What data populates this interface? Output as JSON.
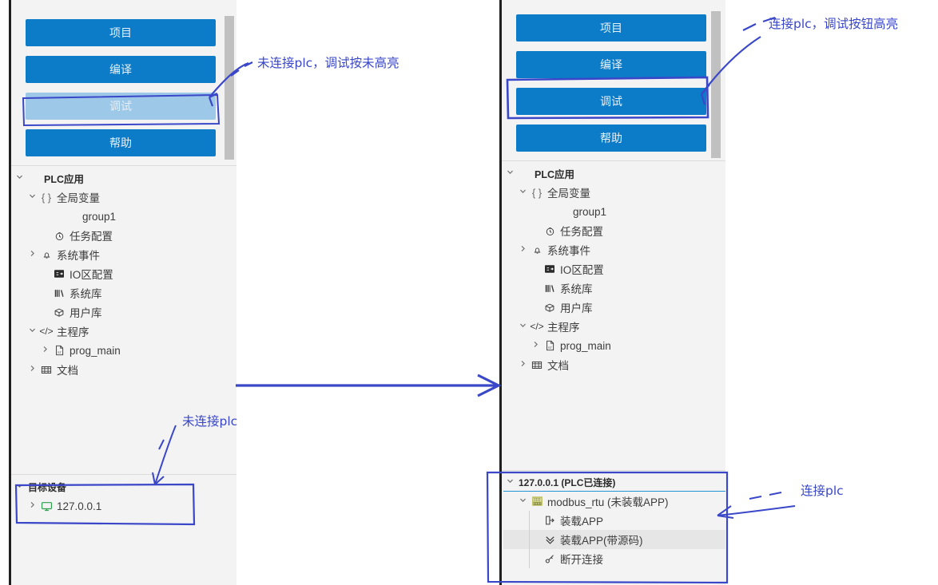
{
  "left_panel": {
    "toolbar_buttons": [
      {
        "label": "项目",
        "state": "enabled"
      },
      {
        "label": "编译",
        "state": "enabled"
      },
      {
        "label": "调试",
        "state": "disabled"
      },
      {
        "label": "帮助",
        "state": "enabled"
      }
    ],
    "tree": [
      {
        "label": "PLC应用",
        "twisty": "chevron-down",
        "icon": "",
        "depth": 0,
        "style": "bold"
      },
      {
        "label": "全局变量",
        "twisty": "chevron-down",
        "icon": "{ }",
        "depth": 1,
        "style": "normal"
      },
      {
        "label": "group1",
        "twisty": "",
        "icon": "",
        "depth": 3,
        "style": "normal"
      },
      {
        "label": "任务配置",
        "twisty": "",
        "icon": "clock",
        "depth": 2,
        "style": "normal"
      },
      {
        "label": "系统事件",
        "twisty": "chevron-right",
        "icon": "bell",
        "depth": 1,
        "style": "normal"
      },
      {
        "label": "IO区配置",
        "twisty": "",
        "icon": "io",
        "depth": 2,
        "style": "normal"
      },
      {
        "label": "系统库",
        "twisty": "",
        "icon": "library",
        "depth": 2,
        "style": "normal"
      },
      {
        "label": "用户库",
        "twisty": "",
        "icon": "box",
        "depth": 2,
        "style": "normal"
      },
      {
        "label": "主程序",
        "twisty": "chevron-down",
        "icon": "code",
        "depth": 1,
        "style": "normal"
      },
      {
        "label": "prog_main",
        "twisty": "chevron-right",
        "icon": "st-file",
        "depth": 2,
        "style": "normal"
      },
      {
        "label": "文档",
        "twisty": "chevron-right",
        "icon": "doc",
        "depth": 1,
        "style": "normal"
      }
    ],
    "dock": {
      "header": "目标设备",
      "header_twisty": "chevron-down",
      "items": [
        {
          "label": "127.0.0.1",
          "twisty": "chevron-right",
          "icon": "monitor"
        }
      ]
    }
  },
  "right_panel": {
    "toolbar_buttons": [
      {
        "label": "项目",
        "state": "enabled"
      },
      {
        "label": "编译",
        "state": "enabled"
      },
      {
        "label": "调试",
        "state": "enabled"
      },
      {
        "label": "帮助",
        "state": "enabled"
      }
    ],
    "tree": [
      {
        "label": "PLC应用",
        "twisty": "chevron-down",
        "icon": "",
        "depth": 0,
        "style": "bold"
      },
      {
        "label": "全局变量",
        "twisty": "chevron-down",
        "icon": "{ }",
        "depth": 1,
        "style": "normal"
      },
      {
        "label": "group1",
        "twisty": "",
        "icon": "",
        "depth": 3,
        "style": "normal"
      },
      {
        "label": "任务配置",
        "twisty": "",
        "icon": "clock",
        "depth": 2,
        "style": "normal"
      },
      {
        "label": "系统事件",
        "twisty": "chevron-right",
        "icon": "bell",
        "depth": 1,
        "style": "normal"
      },
      {
        "label": "IO区配置",
        "twisty": "",
        "icon": "io",
        "depth": 2,
        "style": "normal"
      },
      {
        "label": "系统库",
        "twisty": "",
        "icon": "library",
        "depth": 2,
        "style": "normal"
      },
      {
        "label": "用户库",
        "twisty": "",
        "icon": "box",
        "depth": 2,
        "style": "normal"
      },
      {
        "label": "主程序",
        "twisty": "chevron-down",
        "icon": "code",
        "depth": 1,
        "style": "normal"
      },
      {
        "label": "prog_main",
        "twisty": "chevron-right",
        "icon": "st-file",
        "depth": 2,
        "style": "normal"
      },
      {
        "label": "文档",
        "twisty": "chevron-right",
        "icon": "doc",
        "depth": 1,
        "style": "normal"
      }
    ],
    "dock": {
      "header": "127.0.0.1 (PLC已连接)",
      "header_twisty": "chevron-down",
      "items": [
        {
          "label": "modbus_rtu (未装载APP)",
          "twisty": "chevron-down",
          "icon": "device",
          "depth": 1,
          "selected": false
        },
        {
          "label": "装载APP",
          "twisty": "",
          "icon": "load-app",
          "depth": 2,
          "selected": false
        },
        {
          "label": "装载APP(带源码)",
          "twisty": "",
          "icon": "load-app-src",
          "depth": 2,
          "selected": true
        },
        {
          "label": "断开连接",
          "twisty": "",
          "icon": "disconnect",
          "depth": 2,
          "selected": false
        }
      ]
    }
  },
  "annotations": [
    {
      "id": "ann-left-debug",
      "text": "未连接plc，调试按未高亮"
    },
    {
      "id": "ann-right-debug",
      "text": "连接plc，调试按钮高亮"
    },
    {
      "id": "ann-left-device",
      "text": "未连接plc"
    },
    {
      "id": "ann-right-device",
      "text": "连接plc"
    }
  ],
  "colors": {
    "button_enabled": "#0d7cc8",
    "button_disabled": "#9ec8e8",
    "annotation": "#3a47c8",
    "panel_bg": "#f3f3f3"
  }
}
